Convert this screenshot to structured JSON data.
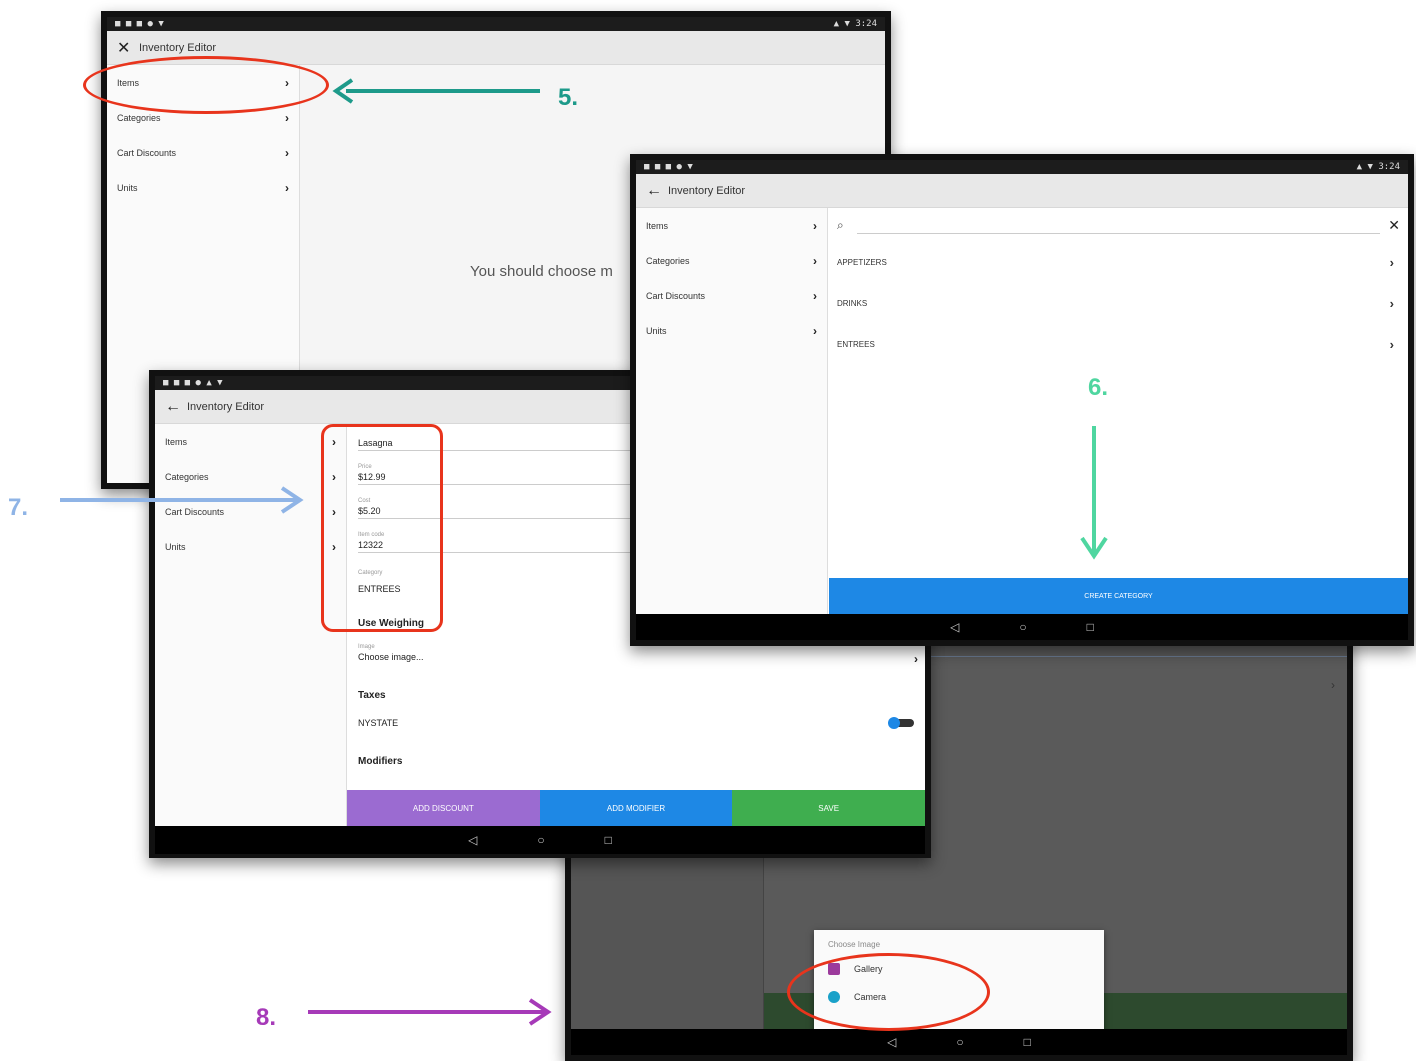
{
  "app_title": "Inventory Editor",
  "sidebar_items": [
    {
      "label": "Items"
    },
    {
      "label": "Categories"
    },
    {
      "label": "Cart Discounts"
    },
    {
      "label": "Units"
    }
  ],
  "screen1": {
    "empty_message": "You should choose m"
  },
  "screen2": {
    "categories": [
      "APPETIZERS",
      "DRINKS",
      "ENTREES"
    ],
    "create_button": "CREATE CATEGORY"
  },
  "screen3": {
    "name_value": "Lasagna",
    "price_label": "Price",
    "price_value": "$12.99",
    "cost_label": "Cost",
    "cost_value": "$5.20",
    "sku_label": "Item code",
    "sku_value": "12322",
    "category_label": "Category",
    "category_value": "ENTREES",
    "weighing_label": "Use Weighing",
    "image_label": "Image",
    "image_value": "Choose image...",
    "taxes_heading": "Taxes",
    "tax_name": "NYSTATE",
    "modifiers_heading": "Modifiers",
    "btn_add_discount": "ADD DISCOUNT",
    "btn_add_modifier": "ADD MODIFIER",
    "btn_save": "SAVE"
  },
  "screen4": {
    "dialog_title": "Choose Image",
    "options": [
      "Gallery",
      "Camera"
    ]
  },
  "steps": {
    "s5": "5.",
    "s6": "6.",
    "s7": "7.",
    "s8": "8."
  },
  "colors": {
    "step5": "#1d9a8a",
    "step6": "#4fd6a0",
    "step7": "#8fb4e6",
    "step8": "#a63ab8",
    "highlight": "#e8341c",
    "blue_button": "#1e88e5",
    "purple_button": "#9b6bd1",
    "green_button": "#3fae4f"
  }
}
